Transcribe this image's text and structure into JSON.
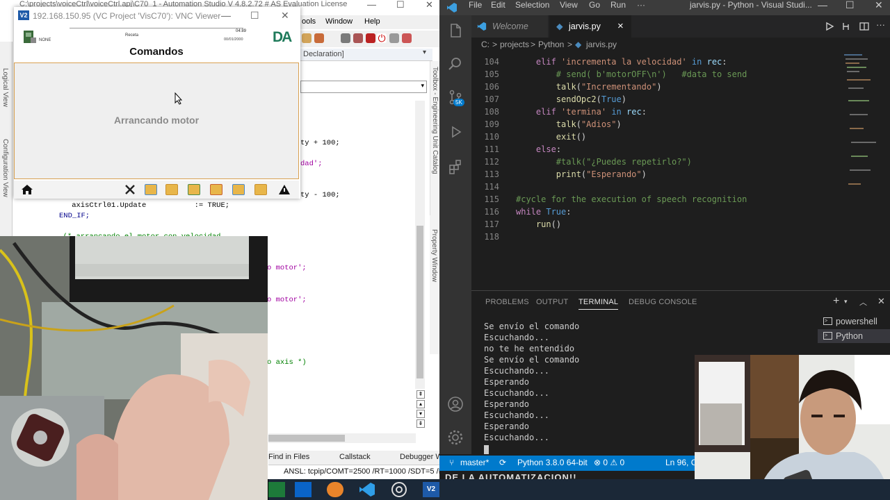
{
  "automation_studio": {
    "title": "C:\\projects\\voiceCtrl\\voiceCtrl.apj\\C70_1 - Automation Studio V 4.8.2.72 # AS Evaluation License",
    "menu": [
      "ools",
      "Window",
      "Help"
    ],
    "tab_label": "Declaration]",
    "side_label_left_1": "Logical View",
    "side_label_left_2": "Configuration View",
    "side_label_right_1": "Toolbox - Engineering Unit Catalog",
    "side_label_right_2": "Property Window",
    "code_lines": [
      {
        "text": "ty + 100;",
        "style": "plain"
      },
      {
        "text": "dad';",
        "style": "str"
      },
      {
        "text": "ty - 100;",
        "style": "plain"
      },
      {
        "text": "    axisCtrl01.Update           := TRUE;",
        "style": "plain"
      },
      {
        "text": "END_IF;",
        "style": "kw"
      },
      {
        "text": "  (* arrancando el motor con velocidad",
        "style": "cmt"
      },
      {
        "text": "o motor';",
        "style": "str"
      },
      {
        "text": "o motor';",
        "style": "str"
      },
      {
        "text": "o axis *)",
        "style": "cmt"
      }
    ],
    "bottom_tabs": [
      "Find in Files",
      "Callstack",
      "Debugger W"
    ],
    "status": "ANSL: tcpip/COMT=2500 /RT=1000 /SDT=5 /I"
  },
  "vnc": {
    "title": "192.168.150.95 (VC Project 'VisC70'): VNC Viewer",
    "logo": "V2",
    "hmi": {
      "user_label": "NONE",
      "recipe_label": "Receta",
      "time": "04:89",
      "date": "00/01/2000",
      "brand": "DA",
      "title": "Comandos",
      "message": "Arrancando motor"
    }
  },
  "vscode": {
    "menu": [
      "File",
      "Edit",
      "Selection",
      "View",
      "Go",
      "Run",
      "···"
    ],
    "window_title": "jarvis.py - Python - Visual Studi...",
    "tabs": {
      "welcome": "Welcome",
      "jarvis": "jarvis.py",
      "close": "×"
    },
    "breadcrumb": [
      "C:",
      ">",
      "projects",
      ">",
      "Python",
      ">",
      "jarvis.py"
    ],
    "scm_badge": "5K",
    "code": [
      {
        "n": "104",
        "tokens": [
          [
            "    ",
            ""
          ],
          [
            "elif",
            "pk"
          ],
          [
            " ",
            ""
          ],
          [
            "'incrementa la velocidad'",
            "ps"
          ],
          [
            " ",
            ""
          ],
          [
            "in",
            "pb"
          ],
          [
            " ",
            ""
          ],
          [
            "rec",
            "pv"
          ],
          [
            ":",
            ""
          ]
        ]
      },
      {
        "n": "105",
        "tokens": [
          [
            "        ",
            ""
          ],
          [
            "# send( b'motorOFF\\n')   #data to send",
            "pc"
          ]
        ]
      },
      {
        "n": "106",
        "tokens": [
          [
            "        ",
            ""
          ],
          [
            "talk",
            "pf"
          ],
          [
            "(",
            ""
          ],
          [
            "\"Incrementando\"",
            "ps"
          ],
          [
            ")",
            ""
          ]
        ]
      },
      {
        "n": "107",
        "tokens": [
          [
            "        ",
            ""
          ],
          [
            "sendOpc2",
            "pf"
          ],
          [
            "(",
            ""
          ],
          [
            "True",
            "pb"
          ],
          [
            ")",
            ""
          ]
        ]
      },
      {
        "n": "108",
        "tokens": [
          [
            "    ",
            ""
          ],
          [
            "elif",
            "pk"
          ],
          [
            " ",
            ""
          ],
          [
            "'termina'",
            "ps"
          ],
          [
            " ",
            ""
          ],
          [
            "in",
            "pb"
          ],
          [
            " ",
            ""
          ],
          [
            "rec",
            "pv"
          ],
          [
            ":",
            ""
          ]
        ]
      },
      {
        "n": "109",
        "tokens": [
          [
            "        ",
            ""
          ],
          [
            "talk",
            "pf"
          ],
          [
            "(",
            ""
          ],
          [
            "\"Adios\"",
            "ps"
          ],
          [
            ")",
            ""
          ]
        ]
      },
      {
        "n": "110",
        "tokens": [
          [
            "        ",
            ""
          ],
          [
            "exit",
            "pf"
          ],
          [
            "()",
            ""
          ]
        ]
      },
      {
        "n": "111",
        "tokens": [
          [
            "    ",
            ""
          ],
          [
            "else",
            "pk"
          ],
          [
            ":",
            ""
          ]
        ]
      },
      {
        "n": "112",
        "tokens": [
          [
            "        ",
            ""
          ],
          [
            "#talk(\"¿Puedes repetirlo?\")",
            "pc"
          ]
        ]
      },
      {
        "n": "113",
        "tokens": [
          [
            "        ",
            ""
          ],
          [
            "print",
            "pf"
          ],
          [
            "(",
            ""
          ],
          [
            "\"Esperando\"",
            "ps"
          ],
          [
            ")",
            ""
          ]
        ]
      },
      {
        "n": "114",
        "tokens": []
      },
      {
        "n": "115",
        "tokens": [
          [
            "#cycle for the execution of speech recognition",
            "pc"
          ]
        ]
      },
      {
        "n": "116",
        "tokens": [
          [
            "while",
            "pk"
          ],
          [
            " ",
            ""
          ],
          [
            "True",
            "pb"
          ],
          [
            ":",
            ""
          ]
        ]
      },
      {
        "n": "117",
        "tokens": [
          [
            "    ",
            ""
          ],
          [
            "run",
            "pf"
          ],
          [
            "()",
            ""
          ]
        ]
      },
      {
        "n": "118",
        "tokens": []
      }
    ],
    "panel_tabs": [
      "PROBLEMS",
      "OUTPUT",
      "TERMINAL",
      "DEBUG CONSOLE"
    ],
    "terminal_lines": [
      "Se envío el comando",
      "Escuchando...",
      "no te he entendido",
      "Se envío el comando",
      "Escuchando...",
      "Esperando",
      "Escuchando...",
      "Esperando",
      "Escuchando...",
      "Esperando",
      "Escuchando..."
    ],
    "terminals": [
      "powershell",
      "Python"
    ],
    "status": {
      "branch": "master*",
      "python": "Python 3.8.0 64-bit",
      "problems": "⊗ 0 ⚠ 0",
      "position": "Ln 96, Co"
    }
  },
  "overlay_banner": "DE LA AUTOMATIZACION!!",
  "colors": {
    "vscode_blue": "#007acc",
    "hmi_border": "#d8a050",
    "editor_bg": "#1e1e1e"
  }
}
